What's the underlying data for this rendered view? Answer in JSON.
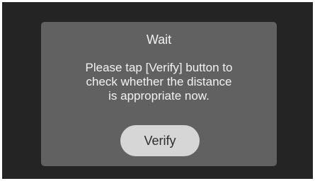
{
  "dialog": {
    "title": "Wait",
    "message_lines": [
      "Please tap [Verify] button to",
      "check whether the distance",
      "is appropriate now."
    ],
    "verify_label": "Verify"
  },
  "colors": {
    "background": "#242424",
    "dialog": "#616161",
    "button": "#d6d6d6",
    "text": "#f2f2f2"
  }
}
